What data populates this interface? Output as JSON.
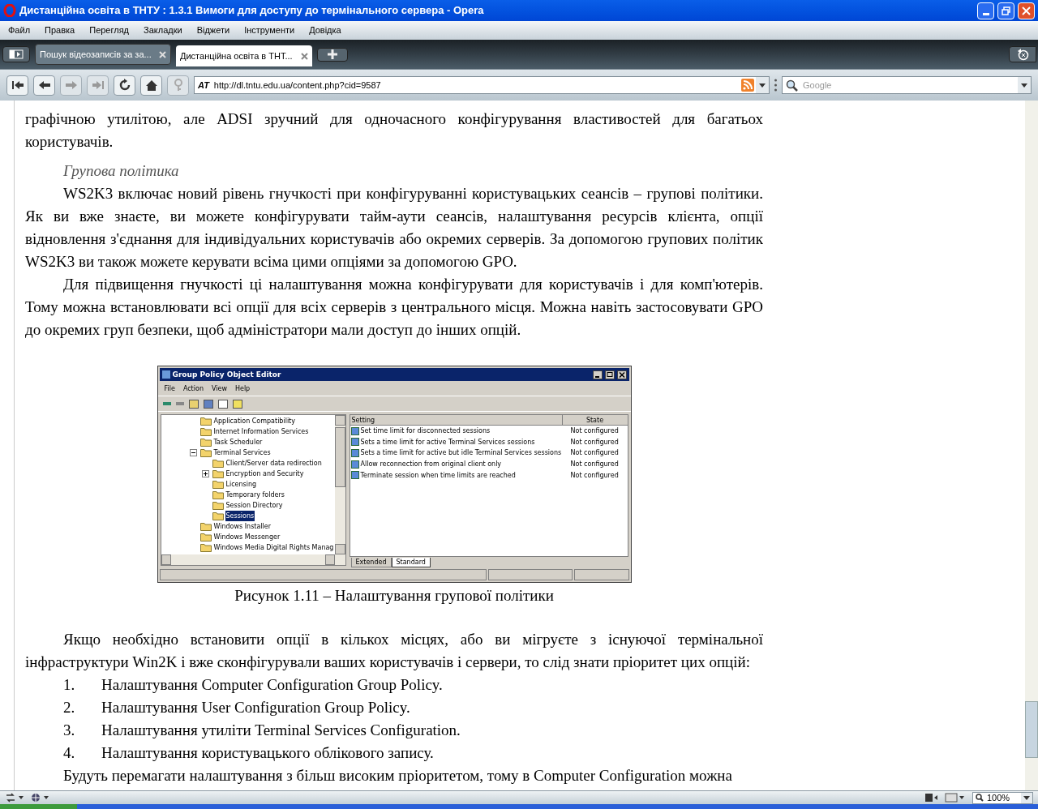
{
  "window": {
    "title": "Дистанційна освіта в ТНТУ : 1.3.1 Вимоги для доступу до термінального сервера - Opera"
  },
  "menu": [
    "Файл",
    "Правка",
    "Перегляд",
    "Закладки",
    "Віджети",
    "Інструменти",
    "Довідка"
  ],
  "tabs": [
    {
      "label": "Пошук відеозаписів за за...",
      "selected": false
    },
    {
      "label": "Дистанційна освіта в ТНТ...",
      "selected": true
    }
  ],
  "address": {
    "badge": "AT",
    "url": "http://dl.tntu.edu.ua/content.php?cid=9587"
  },
  "search": {
    "placeholder": "Google"
  },
  "article": [
    {
      "kind": "continuation",
      "text": "графічною утилітою, але ADSI зручний для одночасного конфігурування властивостей для багатьох користувачів."
    },
    {
      "kind": "heading",
      "text": "Групова політика"
    },
    {
      "kind": "paragraph",
      "text": "WS2K3 включає новий рівень гнучкості при конфігуруванні користувацьких сеансів – групові політики. Як ви вже знаєте, ви можете конфігурувати тайм-аути сеансів, налаштування  ресурсів клієнта, опції відновлення з'єднання для індивідуальних користувачів або окремих серверів. За допомогою групових політик WS2K3 ви також можете керувати всіма цими опціями за допомогою GPO."
    },
    {
      "kind": "paragraph",
      "text": "Для підвищення гнучкості ці налаштування  можна конфігурувати для користувачів і для комп'ютерів. Тому можна встановлювати всі опції для всіх серверів з центрального місця. Можна навіть застосовувати GPO до окремих груп безпеки, щоб адміністратори мали доступ до інших опцій."
    },
    {
      "kind": "figure",
      "caption": "Рисунок 1.11 – Налаштування групової політики",
      "screenshot": {
        "title": "Group Policy Object Editor",
        "menu": [
          "File",
          "Action",
          "View",
          "Help"
        ],
        "tree": [
          {
            "label": "Application Compatibility",
            "selected": false
          },
          {
            "label": "Internet Information Services",
            "selected": false
          },
          {
            "label": "Task Scheduler",
            "selected": false
          },
          {
            "label": "Terminal Services",
            "selected": false,
            "expanded": true,
            "children": [
              {
                "label": "Client/Server data redirection",
                "selected": false
              },
              {
                "label": "Encryption and Security",
                "selected": false,
                "expanded": false
              },
              {
                "label": "Licensing",
                "selected": false
              },
              {
                "label": "Temporary folders",
                "selected": false
              },
              {
                "label": "Session Directory",
                "selected": false
              },
              {
                "label": "Sessions",
                "selected": true
              }
            ]
          },
          {
            "label": "Windows Installer",
            "selected": false
          },
          {
            "label": "Windows Messenger",
            "selected": false
          },
          {
            "label": "Windows Media Digital Rights Manag",
            "selected": false
          }
        ],
        "columns": [
          "Setting",
          "State"
        ],
        "rows": [
          {
            "setting": "Set time limit for disconnected sessions",
            "state": "Not configured"
          },
          {
            "setting": "Sets a time limit for active Terminal Services sessions",
            "state": "Not configured"
          },
          {
            "setting": "Sets a time limit for active but idle Terminal Services sessions",
            "state": "Not configured"
          },
          {
            "setting": "Allow reconnection from original client only",
            "state": "Not configured"
          },
          {
            "setting": "Terminate session when time limits are reached",
            "state": "Not configured"
          }
        ],
        "tabs": [
          {
            "label": "Extended",
            "selected": false
          },
          {
            "label": "Standard",
            "selected": true
          }
        ]
      }
    },
    {
      "kind": "paragraph",
      "text": "Якщо необхідно встановити опції в кількох місцях, або ви мігруєте з існуючої термінальної інфраструктури Win2K і вже сконфігурували ваших користувачів і сервери, то слід знати пріоритет цих опцій:"
    },
    {
      "kind": "list",
      "items": [
        {
          "number": "1.",
          "text": "Налаштування  Computer Configuration Group Policy."
        },
        {
          "number": "2.",
          "text": "Налаштування  User Configuration Group Policy."
        },
        {
          "number": "3.",
          "text": "Налаштування  утиліти Terminal Services Configuration."
        },
        {
          "number": "4.",
          "text": "Налаштування  користувацького облікового запису."
        }
      ]
    },
    {
      "kind": "paragraph",
      "text": "Будуть перемагати налаштування  з більш високим пріоритетом, тому в Computer Configuration можна"
    }
  ],
  "status_bar": {
    "zoom": "100%"
  }
}
